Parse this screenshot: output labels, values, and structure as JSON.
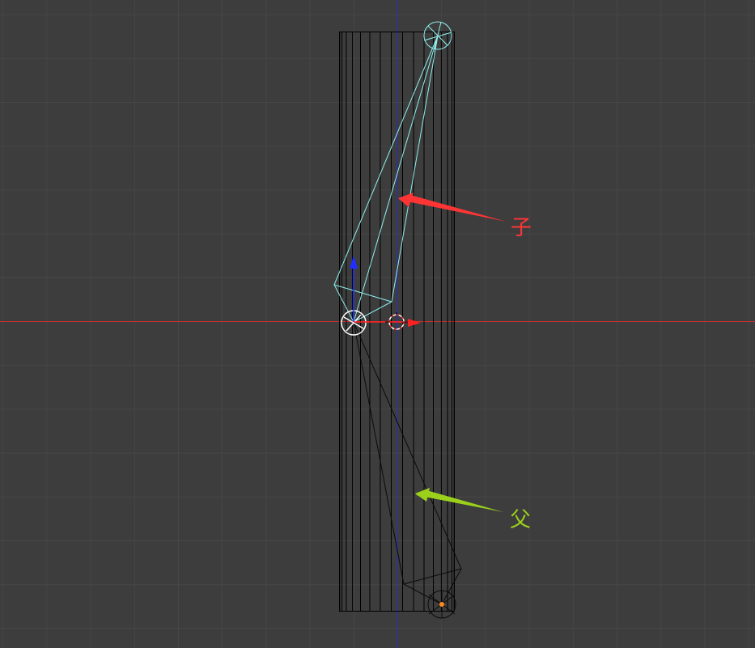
{
  "viewport": {
    "background_color": "#3d3d3d",
    "grid_color": "#474747",
    "x_axis_color": "#cf2f2f",
    "y_axis_color": "#2a2ac8"
  },
  "mesh": {
    "wire_color": "#000000"
  },
  "armature": {
    "child_bone_color": "#8ff0f0",
    "parent_bone_color": "#0a0a0a",
    "selected_head_color": "#ffffff",
    "tail_dot_color": "#ff8a1e"
  },
  "gizmo": {
    "z_arrow_color": "#1f2fff",
    "x_arrow_color": "#ff2020",
    "cursor_color": "#ff3030"
  },
  "annotations": {
    "child_label": "子",
    "child_color": "#ff3535",
    "parent_label": "父",
    "parent_color": "#9bd11a"
  }
}
